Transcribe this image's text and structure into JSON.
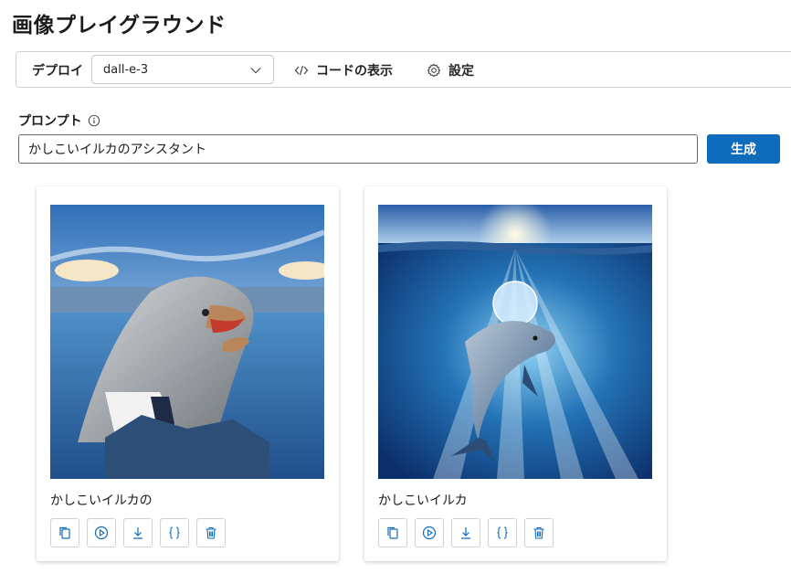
{
  "page": {
    "title": "画像プレイグラウンド"
  },
  "toolbar": {
    "deploy_label": "デプロイ",
    "deploy_value": "dall-e-3",
    "code_label": "コードの表示",
    "settings_label": "設定"
  },
  "prompt": {
    "label": "プロンプト",
    "value": "かしこいイルカのアシスタント",
    "generate_label": "生成"
  },
  "results": [
    {
      "caption": "かしこいイルカの",
      "image": "dolphin in a suit and tie smiling at the ocean surface",
      "actions": [
        "copy-icon",
        "play-icon",
        "download-icon",
        "code-icon",
        "delete-icon"
      ]
    },
    {
      "caption": "かしこいイルカ",
      "image": "dolphin underwater with glowing brain and sun rays",
      "actions": [
        "copy-icon",
        "play-icon",
        "download-icon",
        "code-icon",
        "delete-icon"
      ]
    }
  ],
  "colors": {
    "accent": "#0f6cbd",
    "border": "#d1d1d1",
    "icon": "#0f6cbd"
  }
}
